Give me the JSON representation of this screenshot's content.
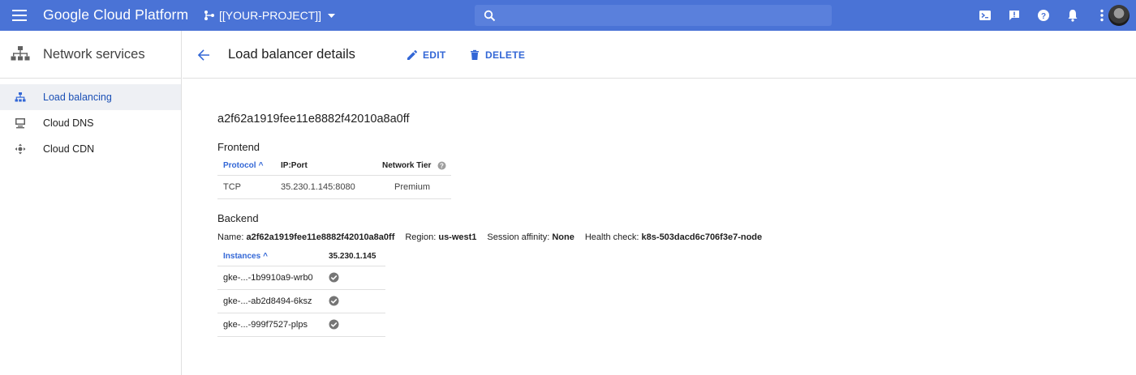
{
  "topbar": {
    "brand": "Google Cloud Platform",
    "project": "[[YOUR-PROJECT]]",
    "icons": [
      "menu-icon",
      "project-icon",
      "chevron-down-icon",
      "search-icon",
      "terminal-icon",
      "alert-icon",
      "help-icon",
      "bell-icon",
      "more-vert-icon",
      "avatar"
    ],
    "bar_color": "#4a73d6"
  },
  "sidebar": {
    "title": "Network services",
    "items": [
      {
        "label": "Load balancing",
        "icon": "load-balancing-icon",
        "active": true
      },
      {
        "label": "Cloud DNS",
        "icon": "dns-icon",
        "active": false
      },
      {
        "label": "Cloud CDN",
        "icon": "cdn-icon",
        "active": false
      }
    ]
  },
  "header": {
    "title": "Load balancer details",
    "edit_label": "EDIT",
    "delete_label": "DELETE",
    "accent": "#3367d6"
  },
  "main": {
    "lb_name": "a2f62a1919fee11e8882f42010a8a0ff",
    "frontend": {
      "title": "Frontend",
      "columns": [
        "Protocol",
        "IP:Port",
        "Network Tier"
      ],
      "sort_arrow": "^",
      "rows": [
        {
          "protocol": "TCP",
          "ip_port": "35.230.1.145:8080",
          "tier": "Premium"
        }
      ]
    },
    "backend": {
      "title": "Backend",
      "name_label": "Name:",
      "name_value": "a2f62a1919fee11e8882f42010a8a0ff",
      "region_label": "Region:",
      "region_value": "us-west1",
      "affinity_label": "Session affinity:",
      "affinity_value": "None",
      "health_label": "Health check:",
      "health_value": "k8s-503dacd6c706f3e7-node",
      "columns": [
        "Instances",
        "35.230.1.145"
      ],
      "sort_arrow": "^",
      "rows": [
        {
          "instance": "gke-...-1b9910a9-wrb0",
          "status": "healthy"
        },
        {
          "instance": "gke-...-ab2d8494-6ksz",
          "status": "healthy"
        },
        {
          "instance": "gke-...-999f7527-plps",
          "status": "healthy"
        }
      ]
    }
  }
}
